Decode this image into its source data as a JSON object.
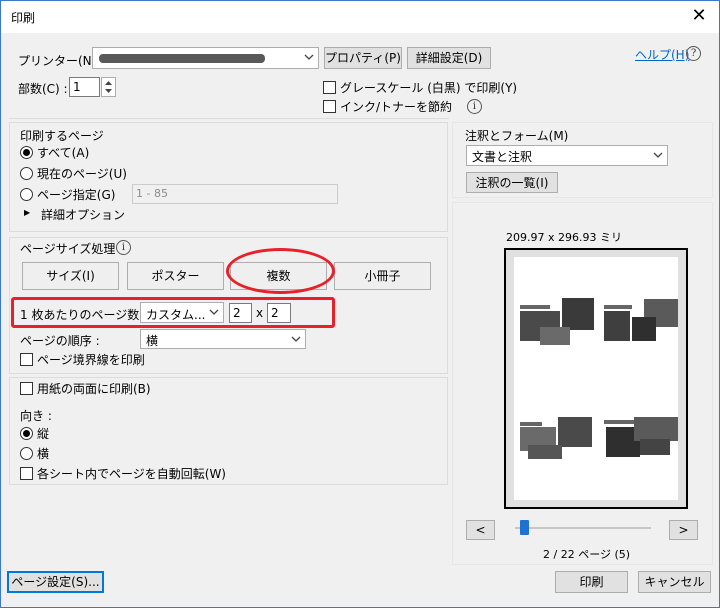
{
  "window": {
    "title": "印刷",
    "close_glyph": "✕"
  },
  "printer": {
    "label": "プリンター(N) :",
    "properties_button": "プロパティ(P)",
    "advanced_button": "詳細設定(D)",
    "help_link": "ヘルプ(H)",
    "help_icon": "?"
  },
  "copies": {
    "label": "部数(C) :",
    "value": "1"
  },
  "options": {
    "grayscale": {
      "label": "グレースケール (白黒) で印刷(Y)",
      "checked": false
    },
    "save_ink": {
      "label": "インク/トナーを節約",
      "checked": false
    },
    "info_icon": "i"
  },
  "pages_to_print": {
    "heading": "印刷するページ",
    "all": {
      "label": "すべて(A)",
      "selected": true
    },
    "current": {
      "label": "現在のページ(U)",
      "selected": false
    },
    "range": {
      "label": "ページ指定(G)",
      "selected": false,
      "placeholder": "1 - 85"
    },
    "more_options": "詳細オプション",
    "expand_glyph": "▶"
  },
  "page_sizing": {
    "heading": "ページサイズ処理",
    "info_icon": "i",
    "buttons": {
      "size": "サイズ(I)",
      "poster": "ポスター",
      "multiple": "複数",
      "booklet": "小冊子"
    },
    "pages_per_sheet_label": "1 枚あたりのページ数 :",
    "pages_per_sheet_value": "カスタム...",
    "cols": "2",
    "times": "x",
    "rows": "2",
    "page_order_label": "ページの順序 :",
    "page_order_value": "横",
    "print_border": {
      "label": "ページ境界線を印刷",
      "checked": false
    }
  },
  "duplex": {
    "label": "用紙の両面に印刷(B)",
    "checked": false
  },
  "orientation": {
    "heading": "向き :",
    "portrait": {
      "label": "縦",
      "selected": true
    },
    "landscape": {
      "label": "横",
      "selected": false
    },
    "auto_rotate": {
      "label": "各シート内でページを自動回転(W)",
      "checked": false
    }
  },
  "comments_forms": {
    "heading": "注釈とフォーム(M)",
    "value": "文書と注釈",
    "summarize_button": "注釈の一覧(I)"
  },
  "preview": {
    "dimensions": "209.97 x 296.93 ミリ",
    "prev_button": "<",
    "next_button": ">",
    "page_indicator": "2 / 22 ページ (5)",
    "slider_fraction": 0.04
  },
  "footer": {
    "page_setup_button": "ページ設定(S)...",
    "print_button": "印刷",
    "cancel_button": "キャンセル"
  },
  "colors": {
    "highlight": "#e8202a",
    "link": "#0066cc",
    "slider": "#1e73d2"
  }
}
